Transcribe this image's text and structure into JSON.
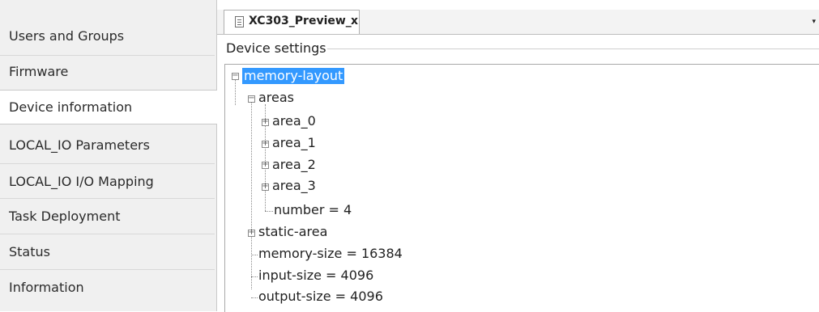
{
  "sidebar": {
    "items": [
      {
        "label": "Users and Groups",
        "active": false
      },
      {
        "label": "Firmware",
        "active": false
      },
      {
        "label": "Device information",
        "active": true
      },
      {
        "label": "LOCAL_IO Parameters",
        "active": false
      },
      {
        "label": "LOCAL_IO I/O Mapping",
        "active": false
      },
      {
        "label": "Task Deployment",
        "active": false
      },
      {
        "label": "Status",
        "active": false
      },
      {
        "label": "Information",
        "active": false
      }
    ]
  },
  "tab": {
    "icon": "document-icon",
    "label": "XC303_Preview_",
    "close": "x",
    "dropdown": "▾"
  },
  "section_title": "Device settings",
  "tree": {
    "root": {
      "label": "memory-layout",
      "expander": "−"
    },
    "areas": {
      "label": "areas",
      "expander": "−"
    },
    "area_0": {
      "label": "area_0",
      "expander": "+"
    },
    "area_1": {
      "label": "area_1",
      "expander": "+"
    },
    "area_2": {
      "label": "area_2",
      "expander": "+"
    },
    "area_3": {
      "label": "area_3",
      "expander": "+"
    },
    "number": {
      "label": "number = 4"
    },
    "static_area": {
      "label": "static-area",
      "expander": "+"
    },
    "memory_size": {
      "label": "memory-size = 16384"
    },
    "input_size": {
      "label": "input-size = 4096"
    },
    "output_size": {
      "label": "output-size = 4096"
    }
  },
  "colors": {
    "selection": "#3399ff",
    "sidebar_bg": "#f0f0f0"
  }
}
